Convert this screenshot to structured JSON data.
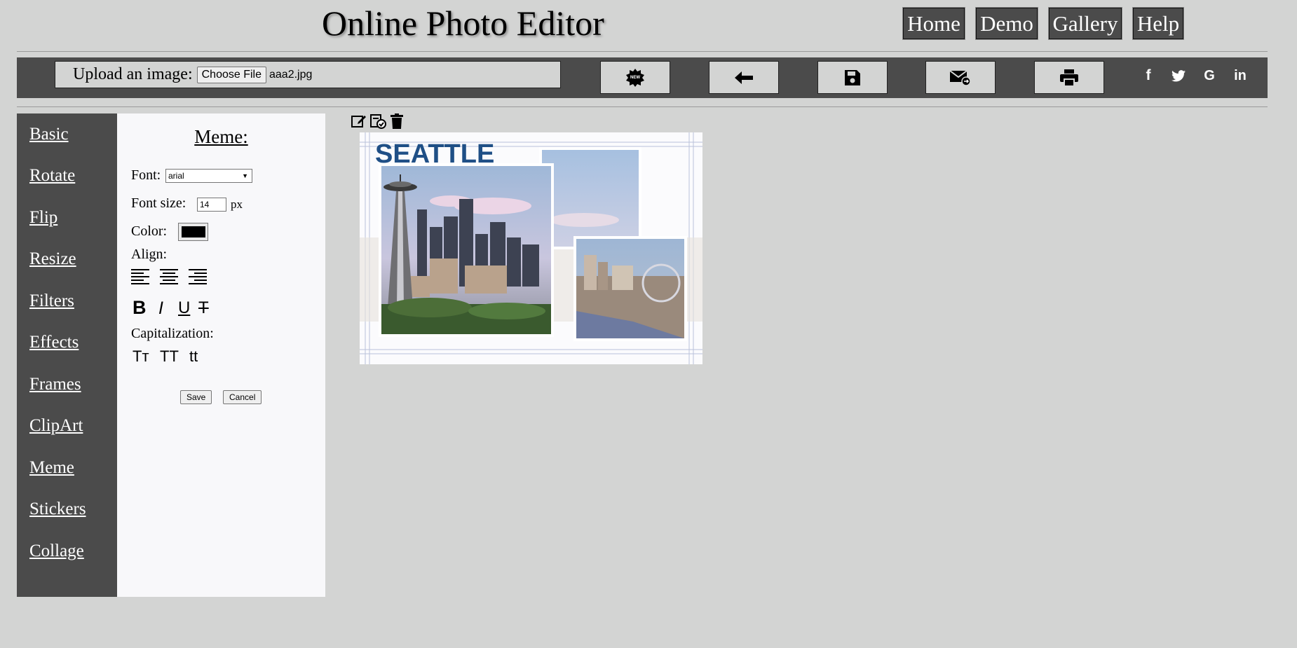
{
  "header": {
    "title": "Online Photo Editor",
    "nav": [
      "Home",
      "Demo",
      "Gallery",
      "Help"
    ]
  },
  "toolbar": {
    "upload_label": "Upload an image:",
    "choose_file_label": "Choose File",
    "file_name": "aaa2.jpg",
    "new_badge": "NEW",
    "tools": [
      "new-icon",
      "undo-arrow-icon",
      "save-disk-icon",
      "email-icon",
      "print-icon"
    ],
    "social": [
      "f",
      "twitter-icon",
      "G",
      "in"
    ]
  },
  "sidebar": {
    "items": [
      "Basic",
      "Rotate",
      "Flip",
      "Resize",
      "Filters",
      "Effects",
      "Frames",
      "ClipArt",
      "Meme",
      "Stickers",
      "Collage"
    ]
  },
  "meme": {
    "title": "Meme:",
    "font_label": "Font:",
    "font_value": "arial",
    "font_size_label": "Font size:",
    "font_size_value": "14",
    "font_size_unit": "px",
    "color_label": "Color:",
    "color_value": "#000000",
    "align_label": "Align:",
    "style_buttons": [
      "B",
      "I",
      "U",
      "T"
    ],
    "capitalization_label": "Capitalization:",
    "cap_buttons": [
      "Tт",
      "TT",
      "tt"
    ],
    "save_label": "Save",
    "cancel_label": "Cancel"
  },
  "canvas": {
    "tools": [
      "edit-icon",
      "apply-icon",
      "trash-icon"
    ],
    "image_caption": "SEATTLE"
  },
  "colors": {
    "background": "#d3d4d3",
    "dark_panel": "#4b4b4b",
    "seattle_blue": "#1f4f86"
  }
}
